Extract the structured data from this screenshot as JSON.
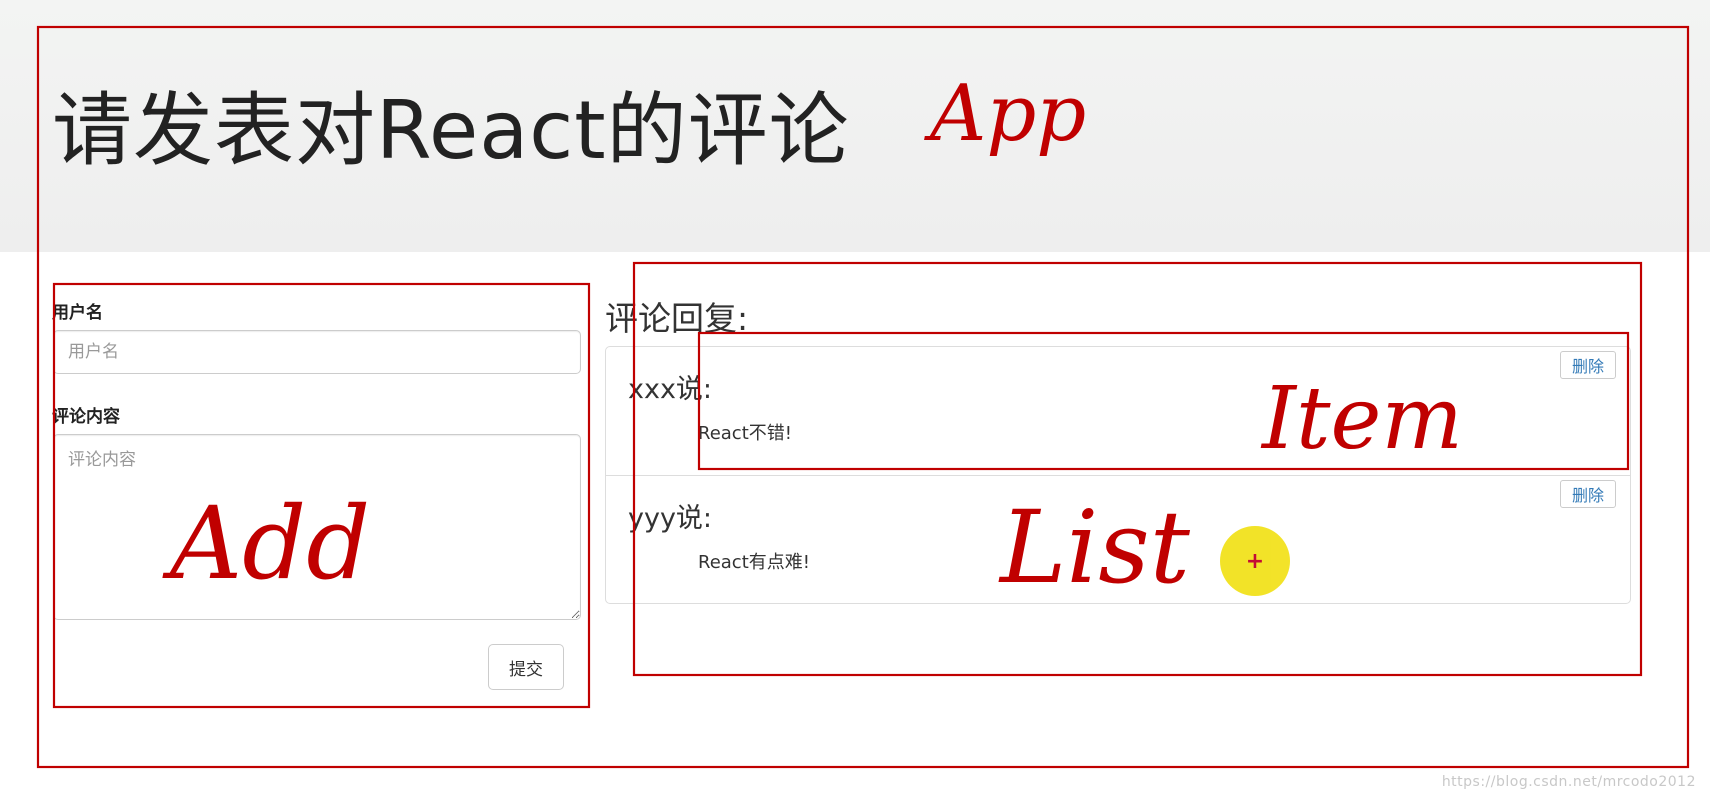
{
  "header": {
    "title": "请发表对React的评论"
  },
  "form": {
    "username_label": "用户名",
    "username_placeholder": "用户名",
    "content_label": "评论内容",
    "content_placeholder": "评论内容",
    "submit_label": "提交"
  },
  "list": {
    "title": "评论回复:",
    "delete_label": "删除",
    "items": [
      {
        "user": "xxx说:",
        "content": "React不错!"
      },
      {
        "user": "yyy说:",
        "content": "React有点难!"
      }
    ]
  },
  "annotations": {
    "app": "App",
    "add": "Add",
    "item": "Item",
    "list": "List"
  },
  "cursor": {
    "glyph": "+"
  },
  "watermark": "https://blog.csdn.net/mrcodo2012",
  "colors": {
    "annotation_red": "#c00000",
    "cursor_yellow": "#f2e21d",
    "link_blue": "#337ab7"
  }
}
